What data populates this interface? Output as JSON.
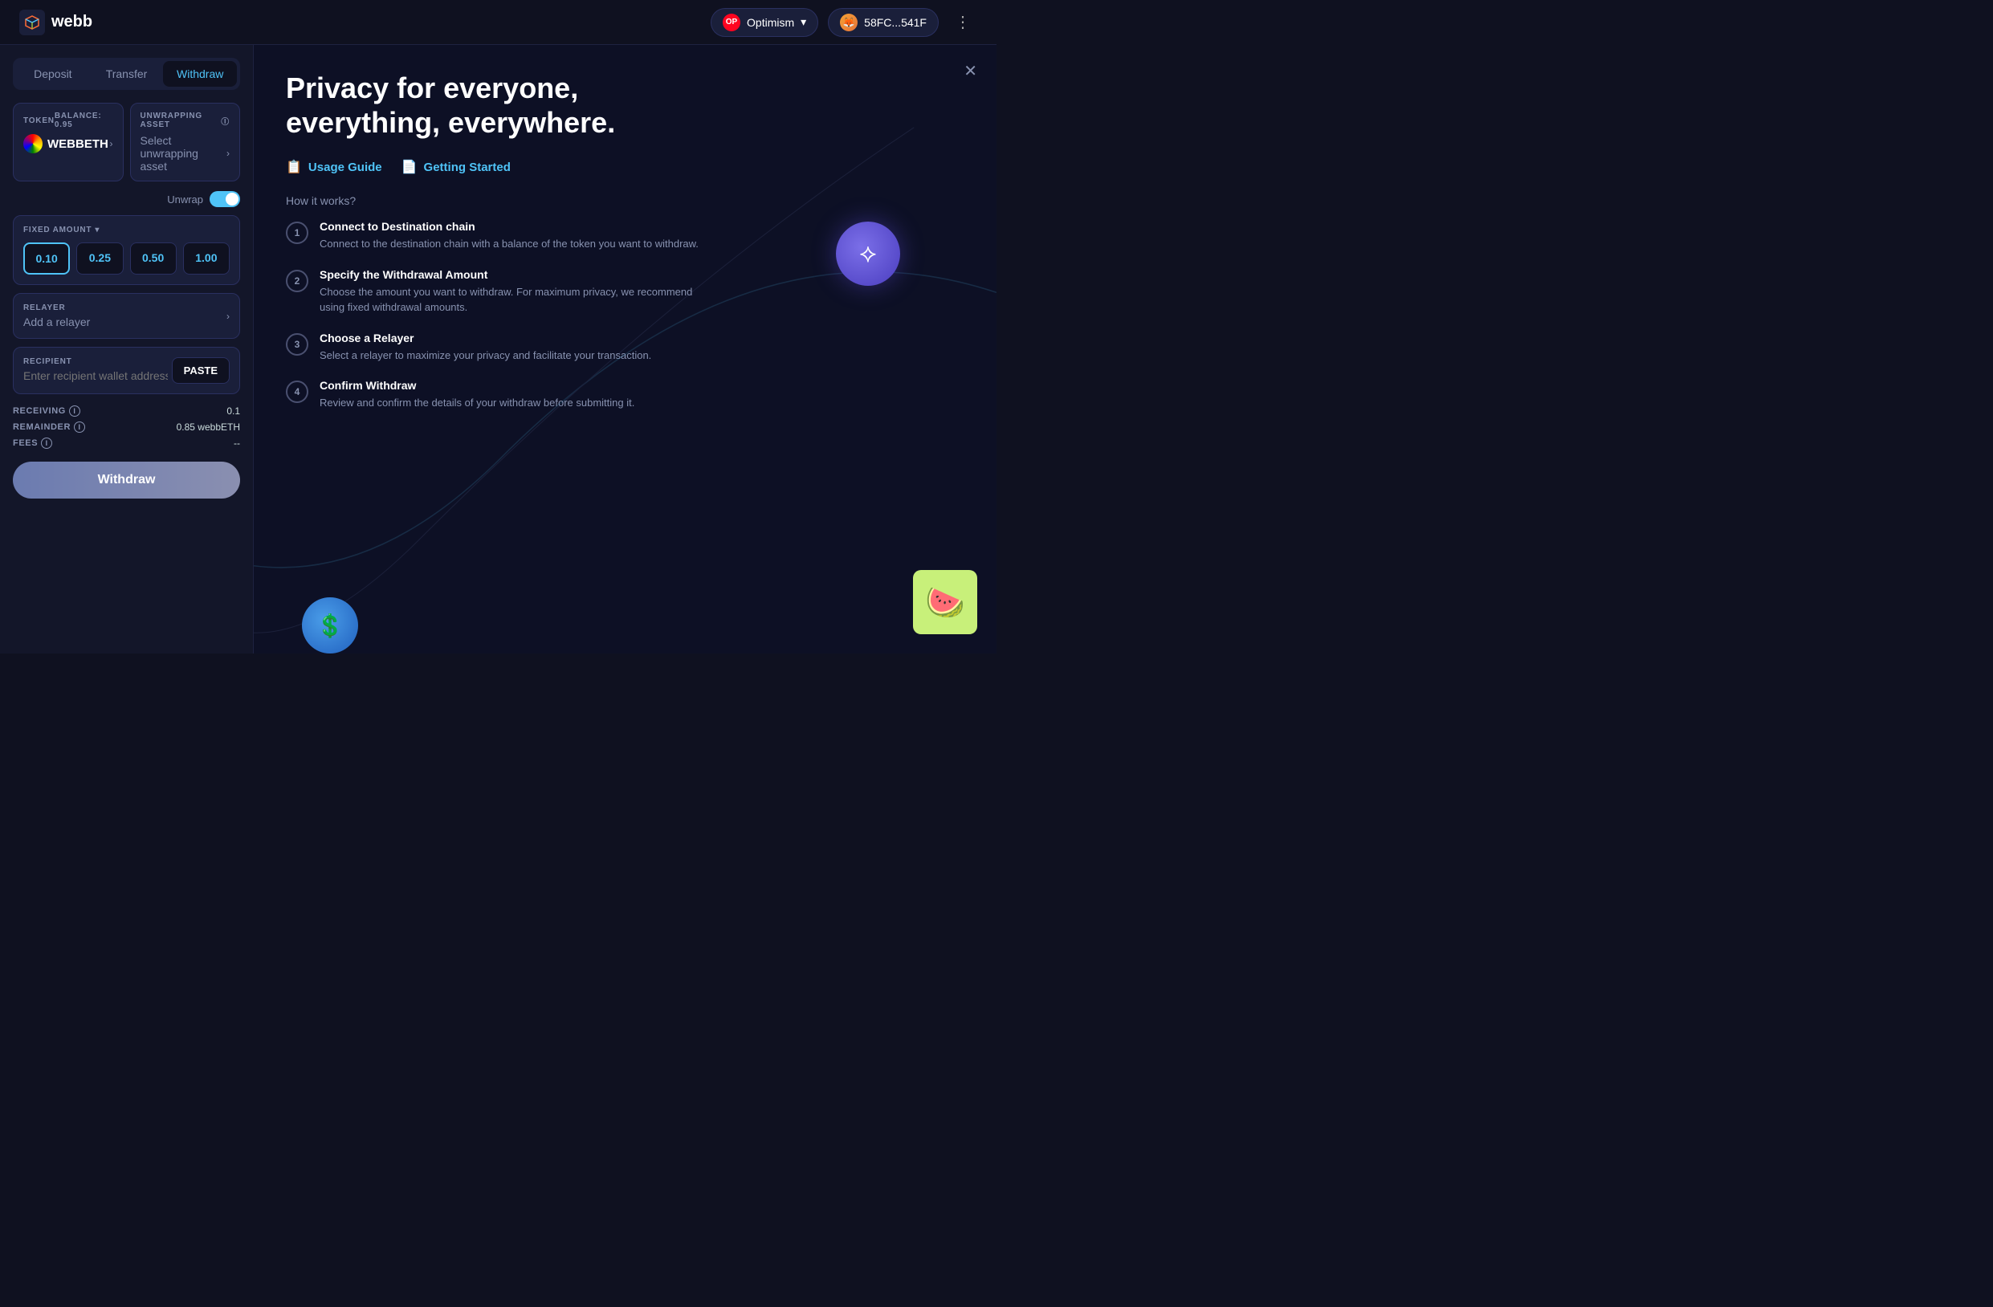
{
  "app": {
    "name": "webb",
    "logo_alt": "webb logo"
  },
  "topnav": {
    "chain_button": {
      "label": "Optimism",
      "symbol": "OP",
      "dropdown_icon": "chevron-down"
    },
    "wallet_button": {
      "label": "58FC...541F"
    },
    "more_icon": "⋮"
  },
  "left_panel": {
    "tabs": [
      {
        "label": "Deposit",
        "active": false
      },
      {
        "label": "Transfer",
        "active": false
      },
      {
        "label": "Withdraw",
        "active": true
      }
    ],
    "token_box": {
      "label": "TOKEN",
      "balance_label": "BALANCE: 0.95",
      "token_name": "WEBBETH"
    },
    "unwrapping_asset": {
      "label": "UNWRAPPING ASSET",
      "info_icon": "ℹ",
      "placeholder": "Select unwrapping asset"
    },
    "unwrap_toggle": {
      "label": "Unwrap",
      "enabled": true
    },
    "amount_section": {
      "label": "FIXED AMOUNT",
      "dropdown_label": "FIXED AMOUNT",
      "amounts": [
        "0.10",
        "0.25",
        "0.50",
        "1.00"
      ],
      "selected_index": 0
    },
    "relayer": {
      "label": "RELAYER",
      "placeholder": "Add a relayer"
    },
    "recipient": {
      "label": "RECIPIENT",
      "placeholder": "Enter recipient wallet address",
      "paste_button": "PASTE"
    },
    "info_rows": [
      {
        "key": "RECEIVING",
        "value": "0.1"
      },
      {
        "key": "REMAINDER",
        "value": "0.85 webbETH"
      },
      {
        "key": "FEES",
        "value": "--"
      }
    ],
    "withdraw_button": "Withdraw"
  },
  "right_panel": {
    "close_button": "✕",
    "hero_title": "Privacy for everyone, everything, everywhere.",
    "guide_tabs": [
      {
        "label": "Usage Guide",
        "icon": "📋"
      },
      {
        "label": "Getting Started",
        "icon": "📄"
      }
    ],
    "how_it_works_label": "How it works?",
    "steps": [
      {
        "number": "1",
        "title": "Connect to Destination chain",
        "description": "Connect to the destination chain with a balance of the token you want to withdraw."
      },
      {
        "number": "2",
        "title": "Specify the Withdrawal Amount",
        "description": "Choose the amount you want to withdraw. For maximum privacy, we recommend using fixed withdrawal amounts."
      },
      {
        "number": "3",
        "title": "Choose a Relayer",
        "description": "Select a relayer to maximize your privacy and facilitate your transaction."
      },
      {
        "number": "4",
        "title": "Confirm Withdraw",
        "description": "Review and confirm the details of your withdraw before submitting it."
      }
    ]
  }
}
